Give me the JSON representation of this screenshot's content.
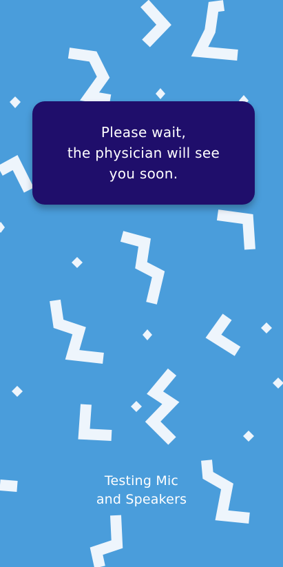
{
  "wait_card": {
    "message": "Please wait,\nthe physician will see\nyou soon."
  },
  "status": {
    "label": "Testing Mic\nand Speakers"
  },
  "colors": {
    "background": "#4a9ddb",
    "card": "#1f0e6b",
    "pattern": "#eef5fc",
    "text": "#ffffff"
  }
}
